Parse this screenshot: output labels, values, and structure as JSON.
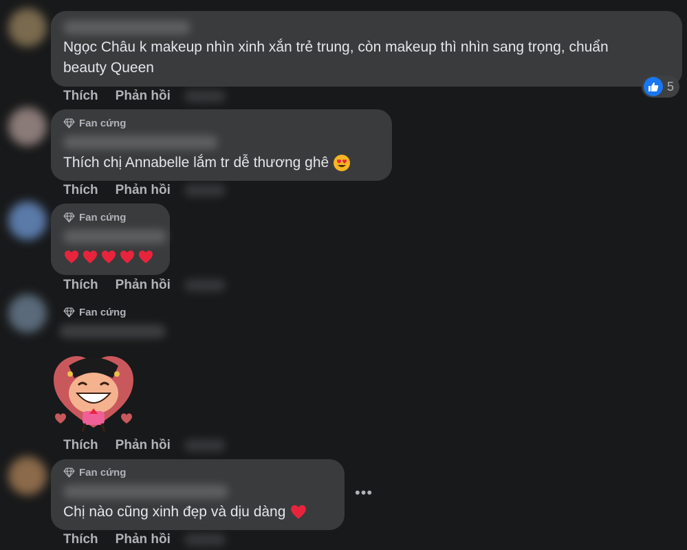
{
  "comments": [
    {
      "text_lines": [
        "Ngọc Châu k makeup nhìn xinh xắn trẻ trung, còn makeup thì nhìn sang trọng, chuẩn",
        "beauty Queen"
      ],
      "reaction": {
        "icon": "like-icon",
        "count": "5"
      },
      "actions": {
        "like": "Thích",
        "reply": "Phản hồi"
      }
    },
    {
      "badge": "Fan cứng",
      "text": "Thích chị Annabelle lắm tr dễ thương ghê",
      "emoji": "heart-eyes-emoji",
      "actions": {
        "like": "Thích",
        "reply": "Phản hồi"
      }
    },
    {
      "badge": "Fan cứng",
      "emoji": "red-heart-emoji x5",
      "actions": {
        "like": "Thích",
        "reply": "Phản hồi"
      }
    },
    {
      "badge": "Fan cứng",
      "sticker": "heart-character-sticker",
      "actions": {
        "like": "Thích",
        "reply": "Phản hồi"
      }
    },
    {
      "badge": "Fan cứng",
      "text": "Chị nào cũng xinh đẹp và dịu dàng",
      "emoji": "red-heart-emoji",
      "more": "more-options-icon",
      "actions": {
        "like": "Thích",
        "reply": "Phản hồi"
      }
    }
  ],
  "colors": {
    "background": "#18191a",
    "bubble": "#3a3b3c",
    "text": "#e4e6eb",
    "secondary_text": "#b0b3b8",
    "like_blue": "#1877f2",
    "heart_red": "#e8243c"
  }
}
